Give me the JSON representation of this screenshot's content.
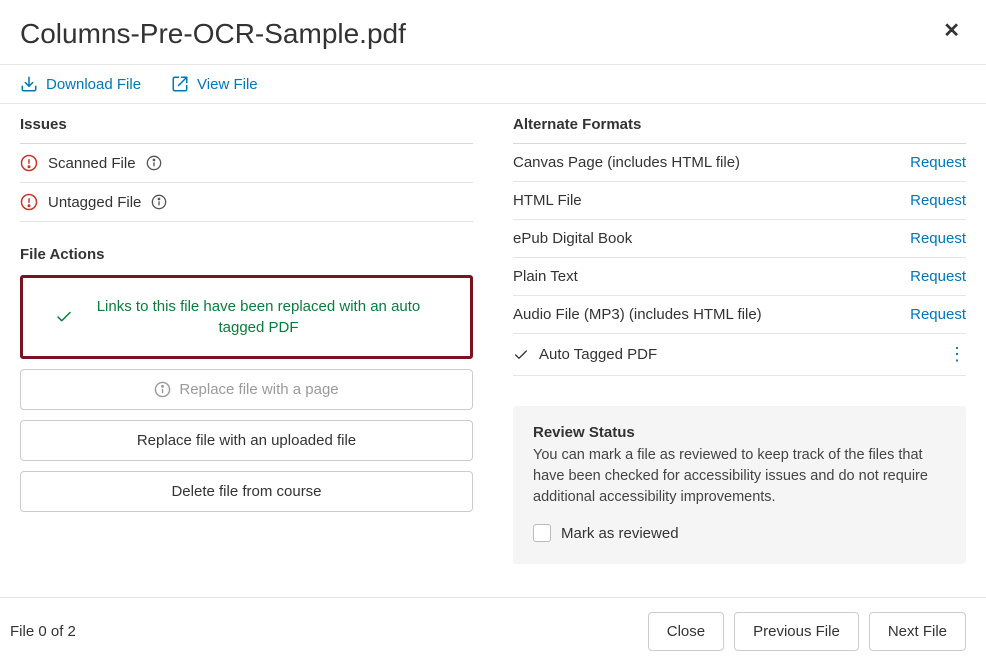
{
  "title": "Columns-Pre-OCR-Sample.pdf",
  "toolbar": {
    "download": "Download File",
    "view": "View File"
  },
  "issues": {
    "heading": "Issues",
    "items": [
      {
        "label": "Scanned File"
      },
      {
        "label": "Untagged File"
      }
    ]
  },
  "fileActions": {
    "heading": "File Actions",
    "successMessage": "Links to this file have been replaced with an auto tagged PDF",
    "replaceWithPage": "Replace file with a page",
    "replaceWithUpload": "Replace file with an uploaded file",
    "deleteFile": "Delete file from course"
  },
  "alternateFormats": {
    "heading": "Alternate Formats",
    "requestLabel": "Request",
    "items": [
      {
        "label": "Canvas Page (includes HTML ﬁle)"
      },
      {
        "label": "HTML File"
      },
      {
        "label": "ePub Digital Book"
      },
      {
        "label": "Plain Text"
      },
      {
        "label": "Audio File (MP3) (includes HTML ﬁle)"
      }
    ],
    "completed": {
      "label": "Auto Tagged PDF"
    }
  },
  "review": {
    "heading": "Review Status",
    "body": "You can mark a ﬁle as reviewed to keep track of the ﬁles that have been checked for accessibility issues and do not require additional accessibility improvements.",
    "markLabel": "Mark as reviewed"
  },
  "footer": {
    "pager": "File 0 of 2",
    "close": "Close",
    "prev": "Previous File",
    "next": "Next File"
  }
}
